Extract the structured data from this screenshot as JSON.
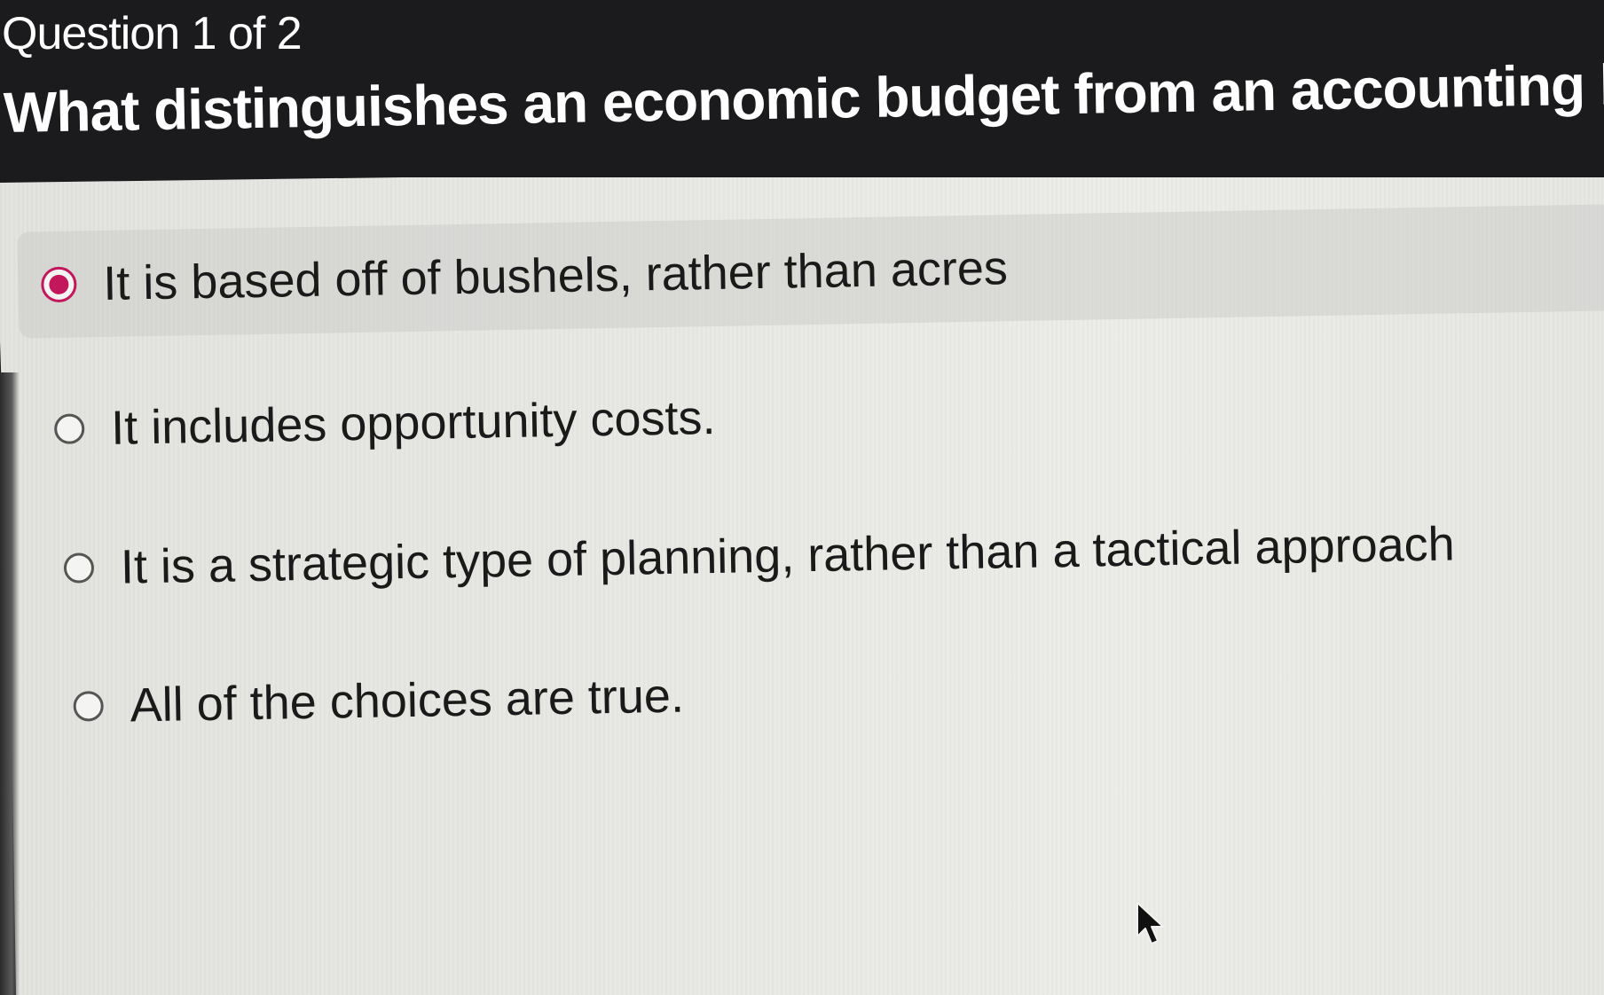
{
  "question": {
    "counter": "Question 1 of 2",
    "text": "What distinguishes an economic budget from an accounting budget?"
  },
  "options": [
    {
      "label": "It is based off of bushels, rather than acres",
      "selected": true
    },
    {
      "label": "It includes opportunity costs.",
      "selected": false
    },
    {
      "label": "It is a strategic type of planning, rather than a tactical approach",
      "selected": false
    },
    {
      "label": "All of the choices are true.",
      "selected": false
    }
  ],
  "colors": {
    "header_bg": "#1b1b1d",
    "panel_bg": "#e8e8e4",
    "accent": "#c2185b"
  },
  "icons": {
    "selected_radio": "radio-checked-icon",
    "unselected_radio": "radio-unchecked-icon",
    "cursor": "mouse-pointer-icon"
  }
}
